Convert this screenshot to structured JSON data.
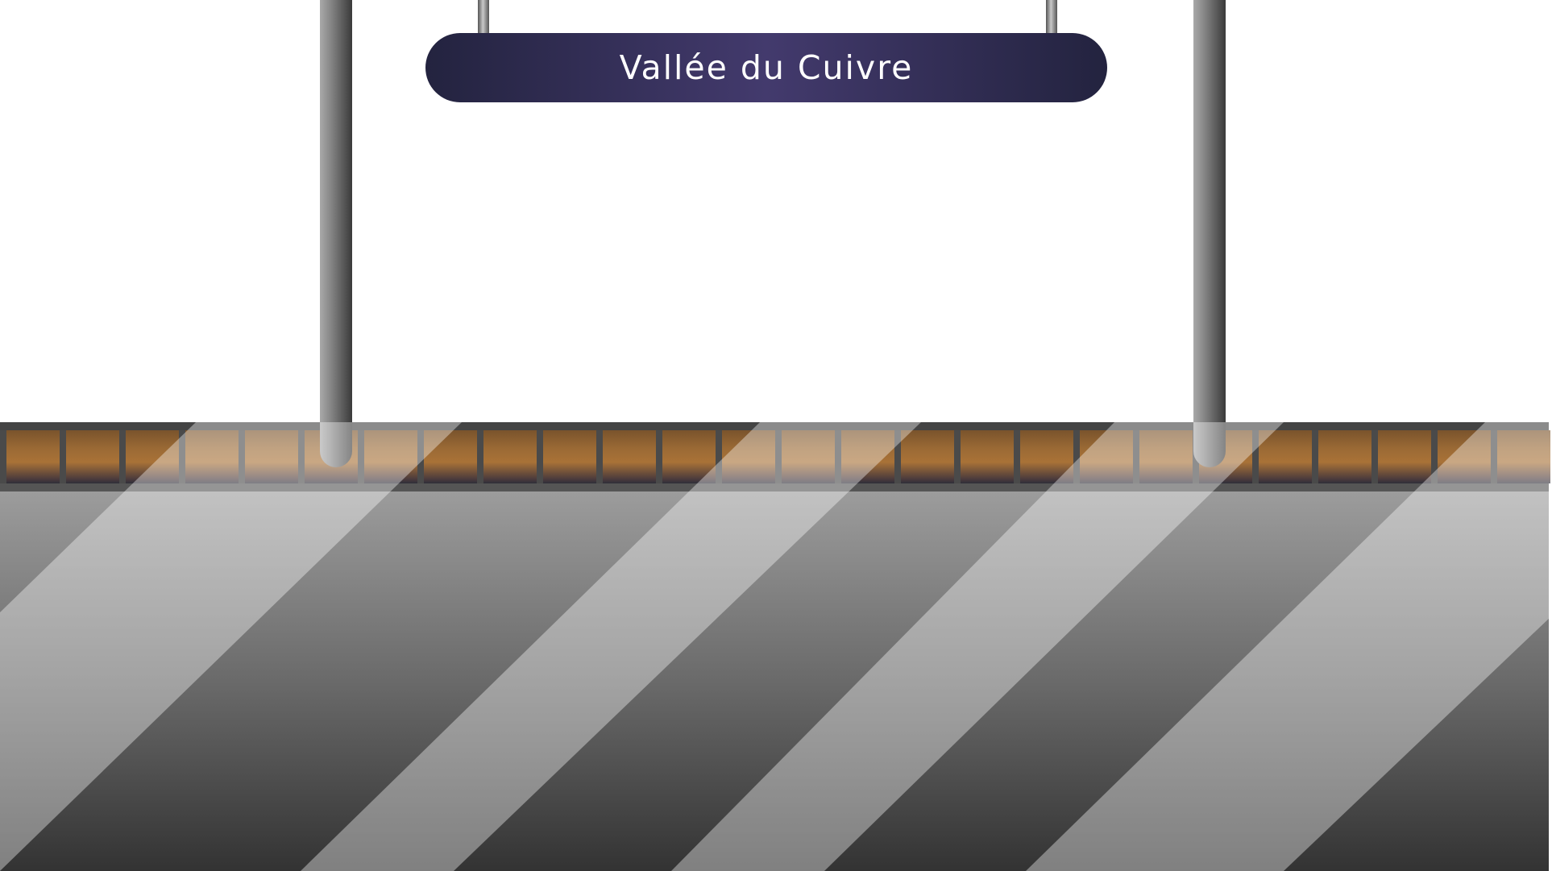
{
  "station": {
    "name": "Vallée du Cuivre"
  },
  "colors": {
    "sign_dark": "#23233f",
    "sign_light": "#433a6d",
    "tile_copper": "#a97237",
    "floor_light": "#9c9c9c",
    "floor_dark": "#333333"
  },
  "platform": {
    "tile_count": 26
  }
}
